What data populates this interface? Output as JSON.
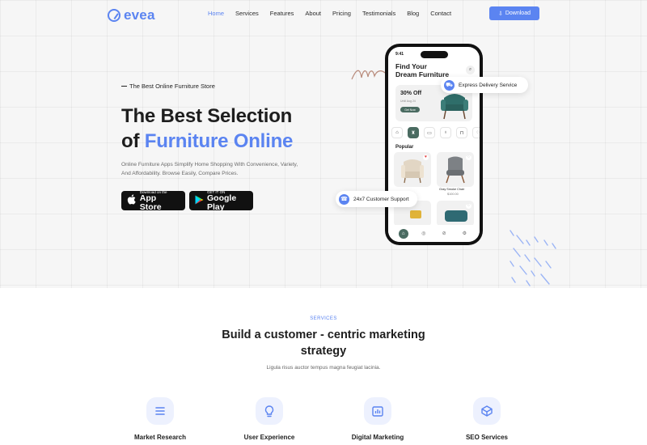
{
  "brand": {
    "name": "evea",
    "accent_color": "#5b84f1"
  },
  "nav": {
    "items": [
      {
        "label": "Home",
        "active": true
      },
      {
        "label": "Services"
      },
      {
        "label": "Features"
      },
      {
        "label": "About"
      },
      {
        "label": "Pricing"
      },
      {
        "label": "Testimonials"
      },
      {
        "label": "Blog"
      },
      {
        "label": "Contact"
      }
    ],
    "download_label": "Download"
  },
  "hero": {
    "eyebrow": "The Best Online Furniture Store",
    "title_line1": "The Best Selection",
    "title_line2_prefix": "of ",
    "title_line2_accent": "Furniture Online",
    "description": "Online Furniture Apps Simplify Home Shopping With Convenience, Variety, And Affordability. Browse Easily, Compare Prices.",
    "app_store": {
      "small": "Download on the",
      "big": "App Store"
    },
    "google_play": {
      "small": "GET IT ON",
      "big": "Google Play"
    }
  },
  "phone": {
    "time": "9:41",
    "title_line1": "Find Your",
    "title_line2": "Dream Furniture",
    "promo": {
      "discount": "30% Off",
      "date": "Until Aug 24",
      "button": "Get Now"
    },
    "section": "Popular",
    "product": {
      "name": "Gray Smoke Chair",
      "price": "$100.00"
    }
  },
  "badges": {
    "express": "Express Delivery Service",
    "support": "24x7 Customer Support"
  },
  "services": {
    "eyebrow": "SERVICES",
    "title": "Build a customer - centric marketing strategy",
    "subtitle": "Ligula risus auctor tempus magna feugiat lacinia.",
    "items": [
      {
        "label": "Market Research",
        "icon": "list-icon"
      },
      {
        "label": "User Experience",
        "icon": "lightbulb-icon"
      },
      {
        "label": "Digital Marketing",
        "icon": "bar-chart-icon"
      },
      {
        "label": "SEO Services",
        "icon": "cube-icon"
      }
    ]
  }
}
